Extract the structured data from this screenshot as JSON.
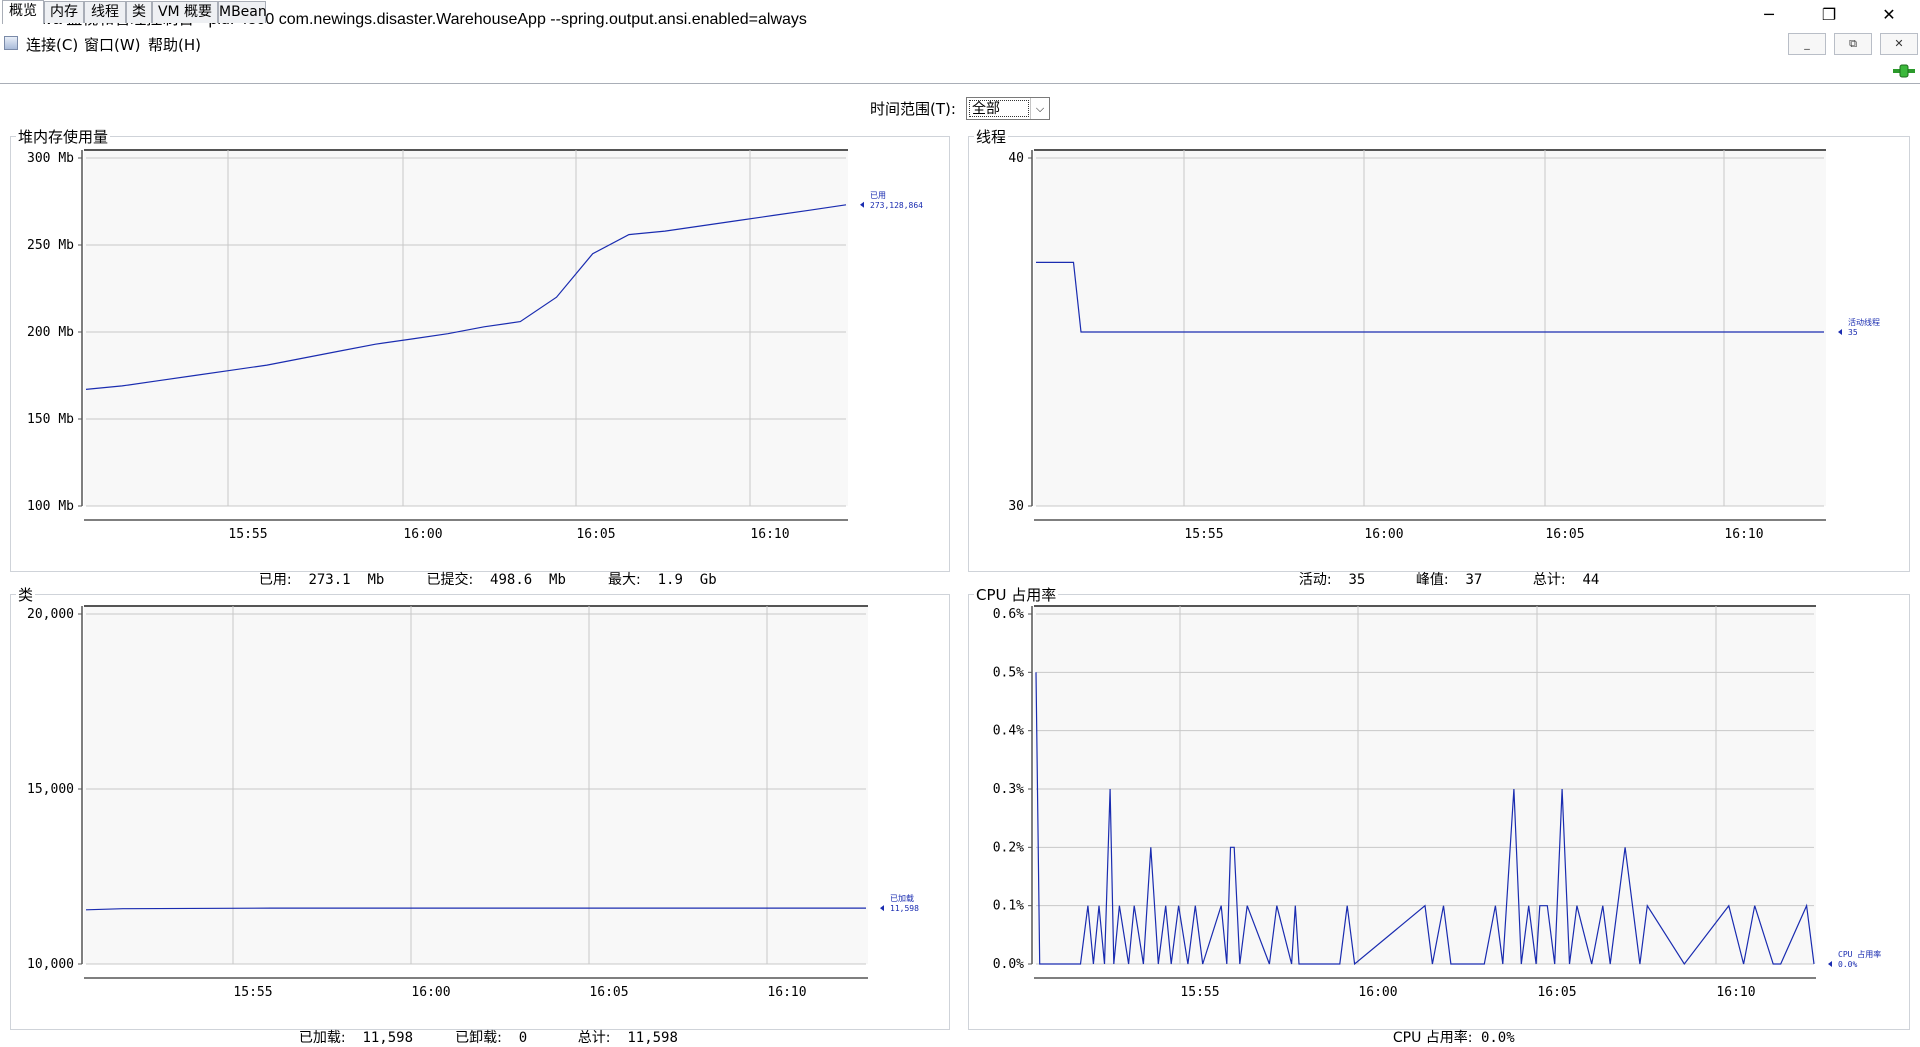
{
  "window": {
    "title": "Java 监视和管理控制台 - pid: 4800 com.newings.disaster.WarehouseApp --spring.output.ansi.enabled=always",
    "minimize": "─",
    "restore": "❐",
    "close": "✕"
  },
  "menu": {
    "items": [
      "连接(C)",
      "窗口(W)",
      "帮助(H)"
    ],
    "mdi_min": "_",
    "mdi_restore": "⧉",
    "mdi_close": "✕"
  },
  "tabs": [
    "概览",
    "内存",
    "线程",
    "类",
    "VM 概要",
    "MBean"
  ],
  "time_range": {
    "label": "时间范围(T):",
    "value": "全部",
    "arrow": "⌵"
  },
  "x_ticks": [
    "15:55",
    "16:00",
    "16:05",
    "16:10"
  ],
  "heap": {
    "title": "堆内存使用量",
    "y_ticks": [
      "300 Mb",
      "250 Mb",
      "200 Mb",
      "150 Mb",
      "100 Mb"
    ],
    "legend_name": "已用",
    "legend_value": "273,128,864",
    "summary": [
      {
        "label": "已用:",
        "value": "273.1  Mb"
      },
      {
        "label": "已提交:",
        "value": "498.6  Mb"
      },
      {
        "label": "最大:",
        "value": "1.9  Gb"
      }
    ]
  },
  "threads": {
    "title": "线程",
    "y_ticks": [
      "40",
      "30"
    ],
    "legend_name": "活动线程",
    "legend_value": "35",
    "summary": [
      {
        "label": "活动:",
        "value": "35"
      },
      {
        "label": "峰值:",
        "value": "37"
      },
      {
        "label": "总计:",
        "value": "44"
      }
    ]
  },
  "classes": {
    "title": "类",
    "y_ticks": [
      "20,000",
      "15,000",
      "10,000"
    ],
    "legend_name": "已加载",
    "legend_value": "11,598",
    "summary": [
      {
        "label": "已加载:",
        "value": "11,598"
      },
      {
        "label": "已卸载:",
        "value": "0"
      },
      {
        "label": "总计:",
        "value": "11,598"
      }
    ]
  },
  "cpu": {
    "title": "CPU 占用率",
    "y_ticks": [
      "0.6%",
      "0.5%",
      "0.4%",
      "0.3%",
      "0.2%",
      "0.1%",
      "0.0%"
    ],
    "legend_name": "CPU 占用率",
    "legend_value": "0.0%",
    "summary": [
      {
        "label": "CPU 占用率:",
        "value": "0.0%"
      }
    ]
  },
  "colors": {
    "series": "#1a2cb0",
    "grid": "#c8c8c8",
    "plot_bg": "#f8f8f8"
  },
  "chart_data": [
    {
      "type": "line",
      "title": "堆内存使用量",
      "ylabel": "Mb",
      "ylim": [
        100,
        300
      ],
      "xlim": [
        "15:51",
        "16:12"
      ],
      "series": [
        {
          "name": "已用",
          "x": [
            "15:51",
            "15:52",
            "15:53",
            "15:54",
            "15:55",
            "15:56",
            "15:57",
            "15:58",
            "15:59",
            "16:00",
            "16:01",
            "16:02",
            "16:03",
            "16:04",
            "16:05",
            "16:06",
            "16:07",
            "16:08",
            "16:09",
            "16:10",
            "16:11",
            "16:12"
          ],
          "values": [
            167,
            169,
            172,
            175,
            178,
            181,
            185,
            189,
            193,
            196,
            199,
            203,
            206,
            220,
            245,
            256,
            258,
            261,
            264,
            267,
            270,
            273.1
          ]
        }
      ]
    },
    {
      "type": "line",
      "title": "线程",
      "ylim": [
        30,
        40
      ],
      "xlim": [
        "15:51",
        "16:12"
      ],
      "series": [
        {
          "name": "活动线程",
          "x": [
            "15:51",
            "15:52",
            "15:52.2",
            "16:12"
          ],
          "values": [
            37,
            37,
            35,
            35
          ]
        }
      ]
    },
    {
      "type": "line",
      "title": "类",
      "ylim": [
        10000,
        20000
      ],
      "xlim": [
        "15:51",
        "16:12"
      ],
      "series": [
        {
          "name": "已加载",
          "x": [
            "15:51",
            "15:52",
            "15:56",
            "16:12"
          ],
          "values": [
            11550,
            11580,
            11598,
            11598
          ]
        }
      ]
    },
    {
      "type": "line",
      "title": "CPU 占用率",
      "ylabel": "%",
      "ylim": [
        0,
        0.6
      ],
      "xlim": [
        "15:51",
        "16:12"
      ],
      "series": [
        {
          "name": "CPU 占用率",
          "x": [
            0,
            0.1,
            0.3,
            1.2,
            1.4,
            1.55,
            1.7,
            1.85,
            2.0,
            2.1,
            2.25,
            2.5,
            2.65,
            2.9,
            3.1,
            3.3,
            3.5,
            3.65,
            3.85,
            4.1,
            4.3,
            4.5,
            5.0,
            5.15,
            5.25,
            5.35,
            5.5,
            5.7,
            6.3,
            6.5,
            6.9,
            7.0,
            7.1,
            8.2,
            8.4,
            8.6,
            10.5,
            10.7,
            11.0,
            11.2,
            12.1,
            12.4,
            12.6,
            12.9,
            13.1,
            13.3,
            13.5,
            13.6,
            13.8,
            14.0,
            14.2,
            14.4,
            14.6,
            15.0,
            15.3,
            15.5,
            15.9,
            16.3,
            16.5,
            17.5,
            18.7,
            19.1,
            19.4,
            19.9,
            20.1,
            20.8,
            21.0
          ],
          "values": [
            0.5,
            0.0,
            0.0,
            0.0,
            0.1,
            0.0,
            0.1,
            0.0,
            0.3,
            0.0,
            0.1,
            0.0,
            0.1,
            0.0,
            0.2,
            0.0,
            0.1,
            0.0,
            0.1,
            0.0,
            0.1,
            0.0,
            0.1,
            0.0,
            0.2,
            0.2,
            0.0,
            0.1,
            0.0,
            0.1,
            0.0,
            0.1,
            0.0,
            0.0,
            0.1,
            0.0,
            0.1,
            0.0,
            0.1,
            0.0,
            0.0,
            0.1,
            0.0,
            0.3,
            0.0,
            0.1,
            0.0,
            0.1,
            0.1,
            0.0,
            0.3,
            0.0,
            0.1,
            0.0,
            0.1,
            0.0,
            0.2,
            0.0,
            0.1,
            0.0,
            0.1,
            0.0,
            0.1,
            0.0,
            0.0,
            0.1,
            0.0
          ]
        }
      ]
    }
  ]
}
